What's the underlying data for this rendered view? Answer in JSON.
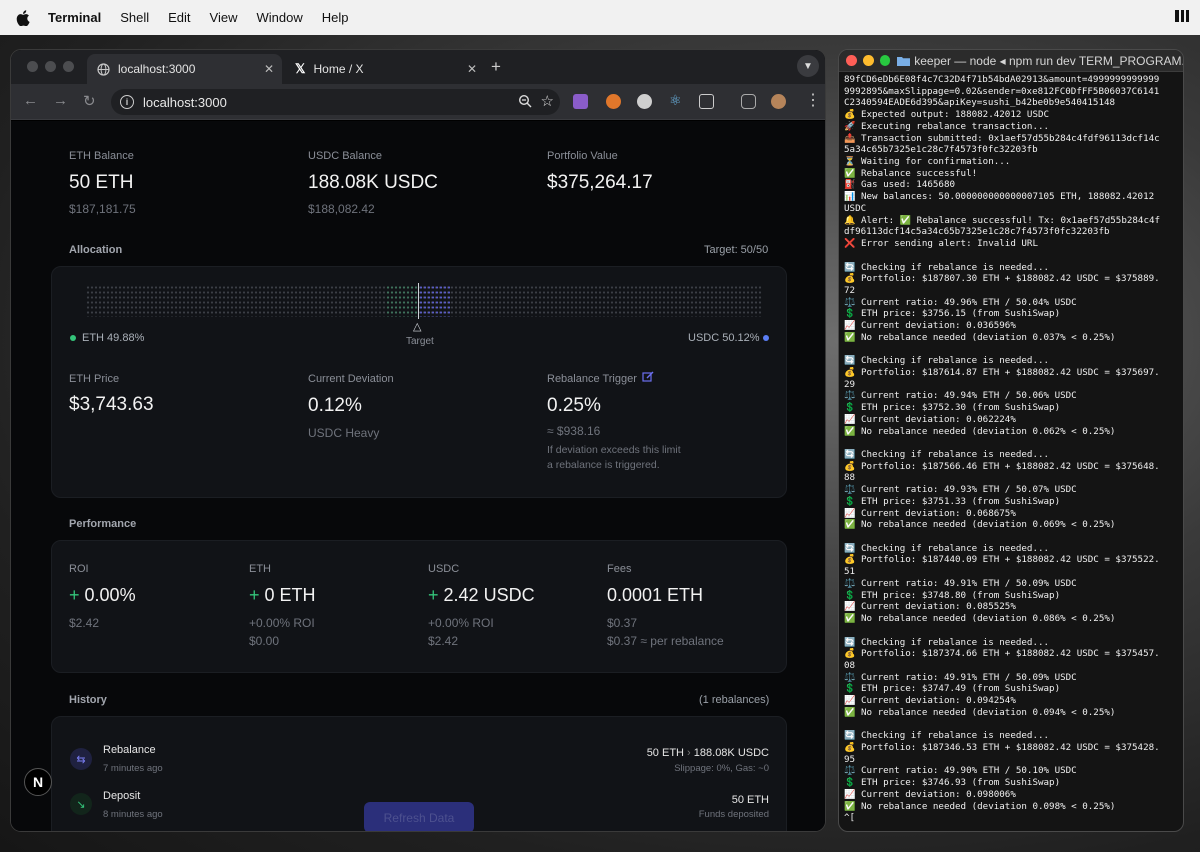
{
  "menubar": {
    "app": "Terminal",
    "items": [
      "Shell",
      "Edit",
      "View",
      "Window",
      "Help"
    ]
  },
  "browser": {
    "tabs": [
      {
        "title": "localhost:3000"
      },
      {
        "title": "Home / X"
      }
    ],
    "url": "localhost:3000"
  },
  "dashboard": {
    "balances": [
      {
        "label": "ETH Balance",
        "value": "50 ETH",
        "sub": "$187,181.75"
      },
      {
        "label": "USDC Balance",
        "value": "188.08K USDC",
        "sub": "$188,082.42"
      },
      {
        "label": "Portfolio Value",
        "value": "$375,264.17",
        "sub": ""
      }
    ],
    "allocation": {
      "title": "Allocation",
      "target": "Target: 50/50",
      "eth_label": "ETH 49.88%",
      "usdc_label": "USDC 50.12%",
      "eth_fraction": 0.4988,
      "marker_label": "Target"
    },
    "stats": [
      {
        "label": "ETH Price",
        "value": "$3,743.63"
      },
      {
        "label": "Current Deviation",
        "value": "0.12%",
        "sub": "USDC Heavy"
      },
      {
        "label": "Rebalance Trigger",
        "value": "0.25%",
        "sub": "≈ $938.16",
        "note1": "If deviation exceeds this limit",
        "note2": "a rebalance is triggered."
      }
    ],
    "performance": {
      "title": "Performance",
      "items": [
        {
          "label": "ROI",
          "plus": "+",
          "value": "0.00%",
          "sub1": "$2.42",
          "sub2": ""
        },
        {
          "label": "ETH",
          "plus": "+",
          "value": "0 ETH",
          "sub1": "+0.00% ROI",
          "sub2": "$0.00"
        },
        {
          "label": "USDC",
          "plus": "+",
          "value": "2.42 USDC",
          "sub1": "+0.00% ROI",
          "sub2": "$2.42"
        },
        {
          "label": "Fees",
          "plus": "",
          "value": "0.0001 ETH",
          "sub1": "$0.37",
          "sub2": "$0.37 ≈ per rebalance"
        }
      ]
    },
    "history": {
      "title": "History",
      "count": "(1 rebalances)",
      "items": [
        {
          "title": "Rebalance",
          "time": "7 minutes ago",
          "from": "50 ETH",
          "to": "188.08K USDC",
          "detail": "Slippage: 0%, Gas: ~0"
        },
        {
          "title": "Deposit",
          "time": "8 minutes ago",
          "amount": "50 ETH",
          "detail": "Funds deposited"
        }
      ],
      "refresh": "Refresh Data"
    },
    "next_badge": "N"
  },
  "terminal": {
    "title": "keeper — node ◂ npm run dev TERM_PROGRAM...",
    "lines": [
      "89fCD6eDb6E08f4c7C32D4f71b54bdA02913&amount=4999999999999",
      "9992895&maxSlippage=0.02&sender=0xe812FC0DfFF5B06037C6141",
      "C2340594EADE6d395&apiKey=sushi_b42be0b9e540415148",
      "💰 Expected output: 188082.42012 USDC",
      "🚀 Executing rebalance transaction...",
      "📤 Transaction submitted: 0x1aef57d55b284c4fdf96113dcf14c",
      "5a34c65b7325e1c28c7f4573f0fc32203fb",
      "⏳ Waiting for confirmation...",
      "✅ Rebalance successful!",
      "⛽ Gas used: 1465680",
      "📊 New balances: 50.000000000000007105 ETH, 188082.42012",
      "USDC",
      "🔔 Alert: ✅ Rebalance successful! Tx: 0x1aef57d55b284c4f",
      "df96113dcf14c5a34c65b7325e1c28c7f4573f0fc32203fb",
      "❌ Error sending alert: Invalid URL",
      "",
      "🔄 Checking if rebalance is needed...",
      "💰 Portfolio: $187807.30 ETH + $188082.42 USDC = $375889.",
      "72",
      "⚖️ Current ratio: 49.96% ETH / 50.04% USDC",
      "💲 ETH price: $3756.15 (from SushiSwap)",
      "📈 Current deviation: 0.036596%",
      "✅ No rebalance needed (deviation 0.037% < 0.25%)",
      "",
      "🔄 Checking if rebalance is needed...",
      "💰 Portfolio: $187614.87 ETH + $188082.42 USDC = $375697.",
      "29",
      "⚖️ Current ratio: 49.94% ETH / 50.06% USDC",
      "💲 ETH price: $3752.30 (from SushiSwap)",
      "📈 Current deviation: 0.062224%",
      "✅ No rebalance needed (deviation 0.062% < 0.25%)",
      "",
      "🔄 Checking if rebalance is needed...",
      "💰 Portfolio: $187566.46 ETH + $188082.42 USDC = $375648.",
      "88",
      "⚖️ Current ratio: 49.93% ETH / 50.07% USDC",
      "💲 ETH price: $3751.33 (from SushiSwap)",
      "📈 Current deviation: 0.068675%",
      "✅ No rebalance needed (deviation 0.069% < 0.25%)",
      "",
      "🔄 Checking if rebalance is needed...",
      "💰 Portfolio: $187440.09 ETH + $188082.42 USDC = $375522.",
      "51",
      "⚖️ Current ratio: 49.91% ETH / 50.09% USDC",
      "💲 ETH price: $3748.80 (from SushiSwap)",
      "📈 Current deviation: 0.085525%",
      "✅ No rebalance needed (deviation 0.086% < 0.25%)",
      "",
      "🔄 Checking if rebalance is needed...",
      "💰 Portfolio: $187374.66 ETH + $188082.42 USDC = $375457.",
      "08",
      "⚖️ Current ratio: 49.91% ETH / 50.09% USDC",
      "💲 ETH price: $3747.49 (from SushiSwap)",
      "📈 Current deviation: 0.094254%",
      "✅ No rebalance needed (deviation 0.094% < 0.25%)",
      "",
      "🔄 Checking if rebalance is needed...",
      "💰 Portfolio: $187346.53 ETH + $188082.42 USDC = $375428.",
      "95",
      "⚖️ Current ratio: 49.90% ETH / 50.10% USDC",
      "💲 ETH price: $3746.93 (from SushiSwap)",
      "📈 Current deviation: 0.098006%",
      "✅ No rebalance needed (deviation 0.098% < 0.25%)",
      "^["
    ]
  }
}
